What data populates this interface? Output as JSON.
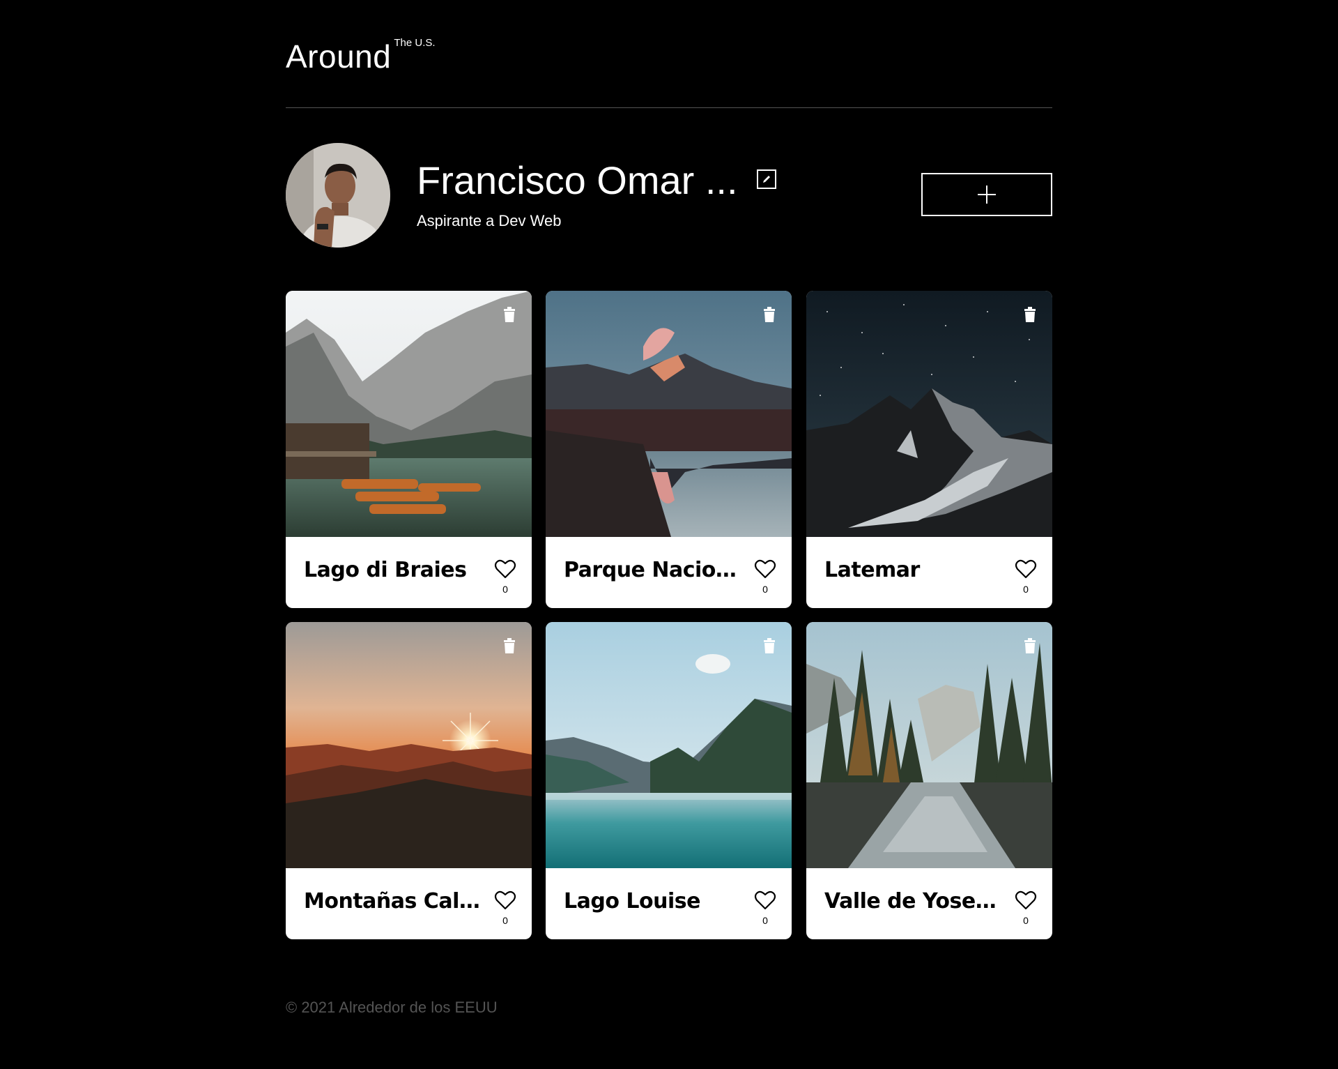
{
  "header": {
    "logo_main": "Around",
    "logo_sup": "The U.S."
  },
  "profile": {
    "name": "Francisco Omar ...",
    "about": "Aspirante a Dev Web",
    "edit_icon": "pencil-edit-icon",
    "add_icon": "plus-icon"
  },
  "cards": [
    {
      "title": "Lago di Braies",
      "likes": "0"
    },
    {
      "title": "Parque Nacional ...",
      "likes": "0"
    },
    {
      "title": "Latemar",
      "likes": "0"
    },
    {
      "title": "Montañas Calvas",
      "likes": "0"
    },
    {
      "title": "Lago Louise",
      "likes": "0"
    },
    {
      "title": "Valle de Yosemite",
      "likes": "0"
    }
  ],
  "footer": {
    "copyright": "© 2021 Alrededor de los EEUU"
  },
  "colors": {
    "background": "#000000",
    "text": "#ffffff",
    "card": "#ffffff",
    "divider": "#545454",
    "footer_text": "#545454"
  }
}
